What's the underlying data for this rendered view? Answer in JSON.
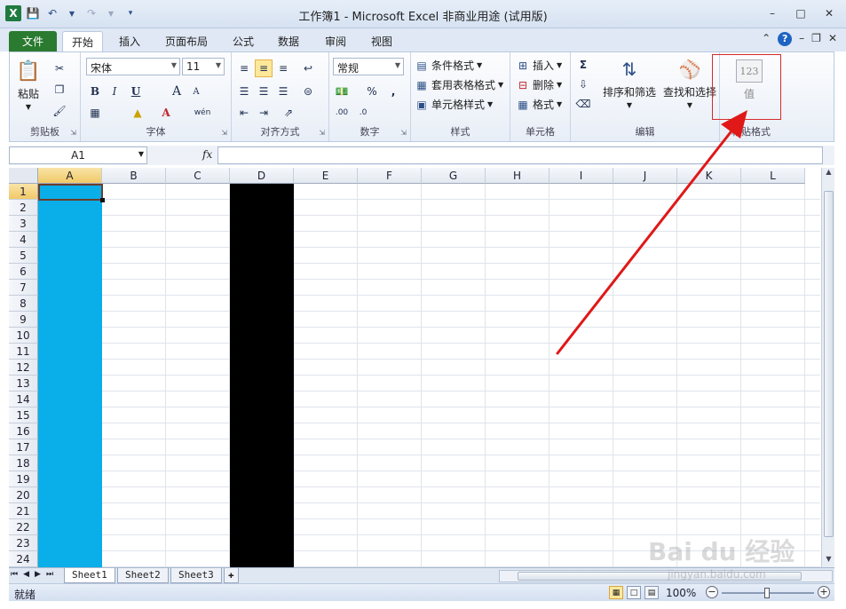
{
  "window": {
    "title": "工作簿1 - Microsoft Excel 非商业用途 (试用版)"
  },
  "tabs": [
    {
      "label": "文件"
    },
    {
      "label": "开始"
    },
    {
      "label": "插入"
    },
    {
      "label": "页面布局"
    },
    {
      "label": "公式"
    },
    {
      "label": "数据"
    },
    {
      "label": "审阅"
    },
    {
      "label": "视图"
    }
  ],
  "ribbon": {
    "clipboard": {
      "label": "剪贴板",
      "paste": "粘贴"
    },
    "font": {
      "label": "字体",
      "name": "宋体",
      "size": "11",
      "bold": "B",
      "italic": "I",
      "underline": "U",
      "grow": "A",
      "shrink": "A",
      "color": "A",
      "phonetic": "wén"
    },
    "alignment": {
      "label": "对齐方式"
    },
    "number": {
      "label": "数字",
      "format": "常规"
    },
    "styles": {
      "label": "样式",
      "conditional": "条件格式",
      "table": "套用表格格式",
      "cell": "单元格样式"
    },
    "cells": {
      "label": "单元格",
      "insert": "插入",
      "delete": "删除",
      "format": "格式"
    },
    "editing": {
      "label": "编辑",
      "sort": "排序和筛选",
      "find": "查找和选择"
    },
    "paste_format": {
      "label": "粘贴格式",
      "values": "值",
      "values_icon": "123"
    }
  },
  "formula_bar": {
    "name_box": "A1",
    "fx": "fx",
    "formula": ""
  },
  "grid": {
    "columns": [
      "A",
      "B",
      "C",
      "D",
      "E",
      "F",
      "G",
      "H",
      "I",
      "J",
      "K",
      "L"
    ],
    "rows": [
      "1",
      "2",
      "3",
      "4",
      "5",
      "6",
      "7",
      "8",
      "9",
      "10",
      "11",
      "12",
      "13",
      "14",
      "15",
      "16",
      "17",
      "18",
      "19",
      "20",
      "21",
      "22",
      "23",
      "24"
    ],
    "selected_cell": "A1",
    "column_a_fill": "#0aaee8",
    "column_d_fill": "#000000"
  },
  "sheets": [
    {
      "label": "Sheet1"
    },
    {
      "label": "Sheet2"
    },
    {
      "label": "Sheet3"
    }
  ],
  "status": {
    "ready": "就绪",
    "zoom": "100%"
  },
  "watermark": {
    "brand": "Bai du 经验",
    "url": "jingyan.baidu.com"
  }
}
